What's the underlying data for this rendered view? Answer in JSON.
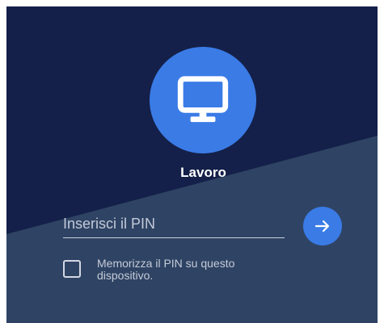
{
  "profile": {
    "icon": "monitor-icon",
    "name": "Lavoro"
  },
  "pin": {
    "placeholder": "Inserisci il PIN",
    "value": "",
    "submit_icon": "arrow-right-icon"
  },
  "remember": {
    "checked": false,
    "label": "Memorizza il PIN su questo dispositivo."
  },
  "colors": {
    "background_dark": "#142049",
    "background_light": "#2f4464",
    "accent": "#3a7be6"
  }
}
